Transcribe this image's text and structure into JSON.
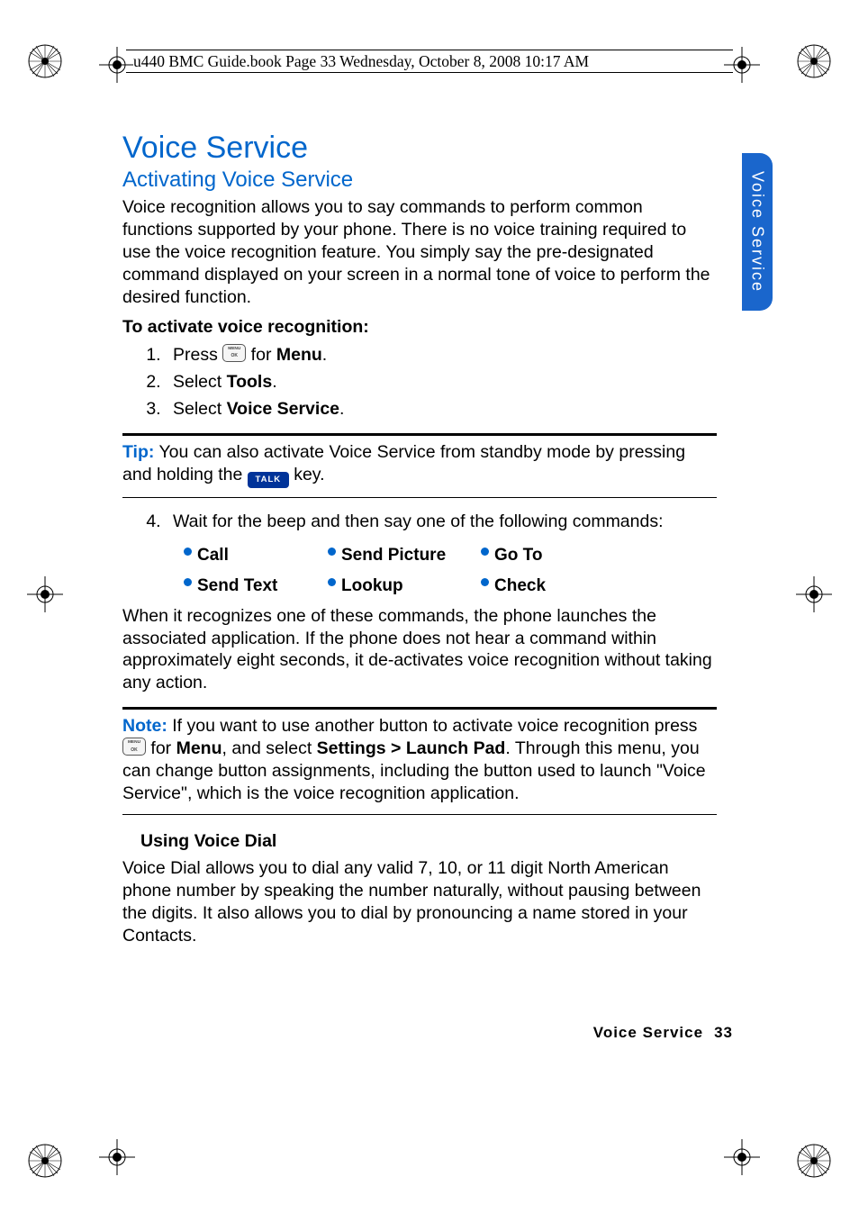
{
  "header": {
    "line": "u440 BMC Guide.book  Page 33  Wednesday, October 8, 2008  10:17 AM"
  },
  "side_tab": "Voice Service",
  "title": "Voice Service",
  "section1": {
    "heading": "Activating Voice Service",
    "intro": "Voice recognition allows you to say commands to perform common functions supported by your phone. There is no voice training required to use the voice recognition feature. You simply say the pre-designated command displayed on your screen in a normal tone of voice to perform the desired function.",
    "instr_head": "To activate voice recognition:",
    "steps": {
      "s1_a": "Press ",
      "s1_b": " for ",
      "s1_menu": "Menu",
      "s1_c": ".",
      "s2_a": "Select ",
      "s2_tools": "Tools",
      "s2_b": ".",
      "s3_a": "Select ",
      "s3_vs": "Voice Service",
      "s3_b": "."
    }
  },
  "tip": {
    "label": "Tip:",
    "a": " You can also activate Voice Service from standby mode by pressing and holding the ",
    "talk": "TALK",
    "b": " key."
  },
  "step4": "Wait for the beep and then say one of the following commands:",
  "commands": {
    "c1": "Call",
    "c2": "Send Picture",
    "c3": "Go To",
    "c4": "Send Text",
    "c5": "Lookup",
    "c6": "Check"
  },
  "after_cmds": "When it recognizes one of these commands, the phone launches the associated application. If the phone does not hear a command within approximately eight seconds, it de-activates voice recognition without taking any action.",
  "note": {
    "label": "Note:",
    "a": " If you want to use another button to activate voice recognition press ",
    "b": " for ",
    "menu": "Menu",
    "c": ", and select ",
    "path": "Settings > Launch Pad",
    "d": ". Through this menu, you can change button assignments, including the button used to launch \"Voice Service\", which is the voice recognition application."
  },
  "section2": {
    "heading": "Using Voice Dial",
    "body": "Voice Dial allows you to dial any valid 7, 10, or 11 digit North American phone number by speaking the number naturally, without pausing between the digits. It also allows you to dial by pronouncing a name stored in your Contacts."
  },
  "footer": {
    "label": "Voice Service",
    "page": "33"
  }
}
